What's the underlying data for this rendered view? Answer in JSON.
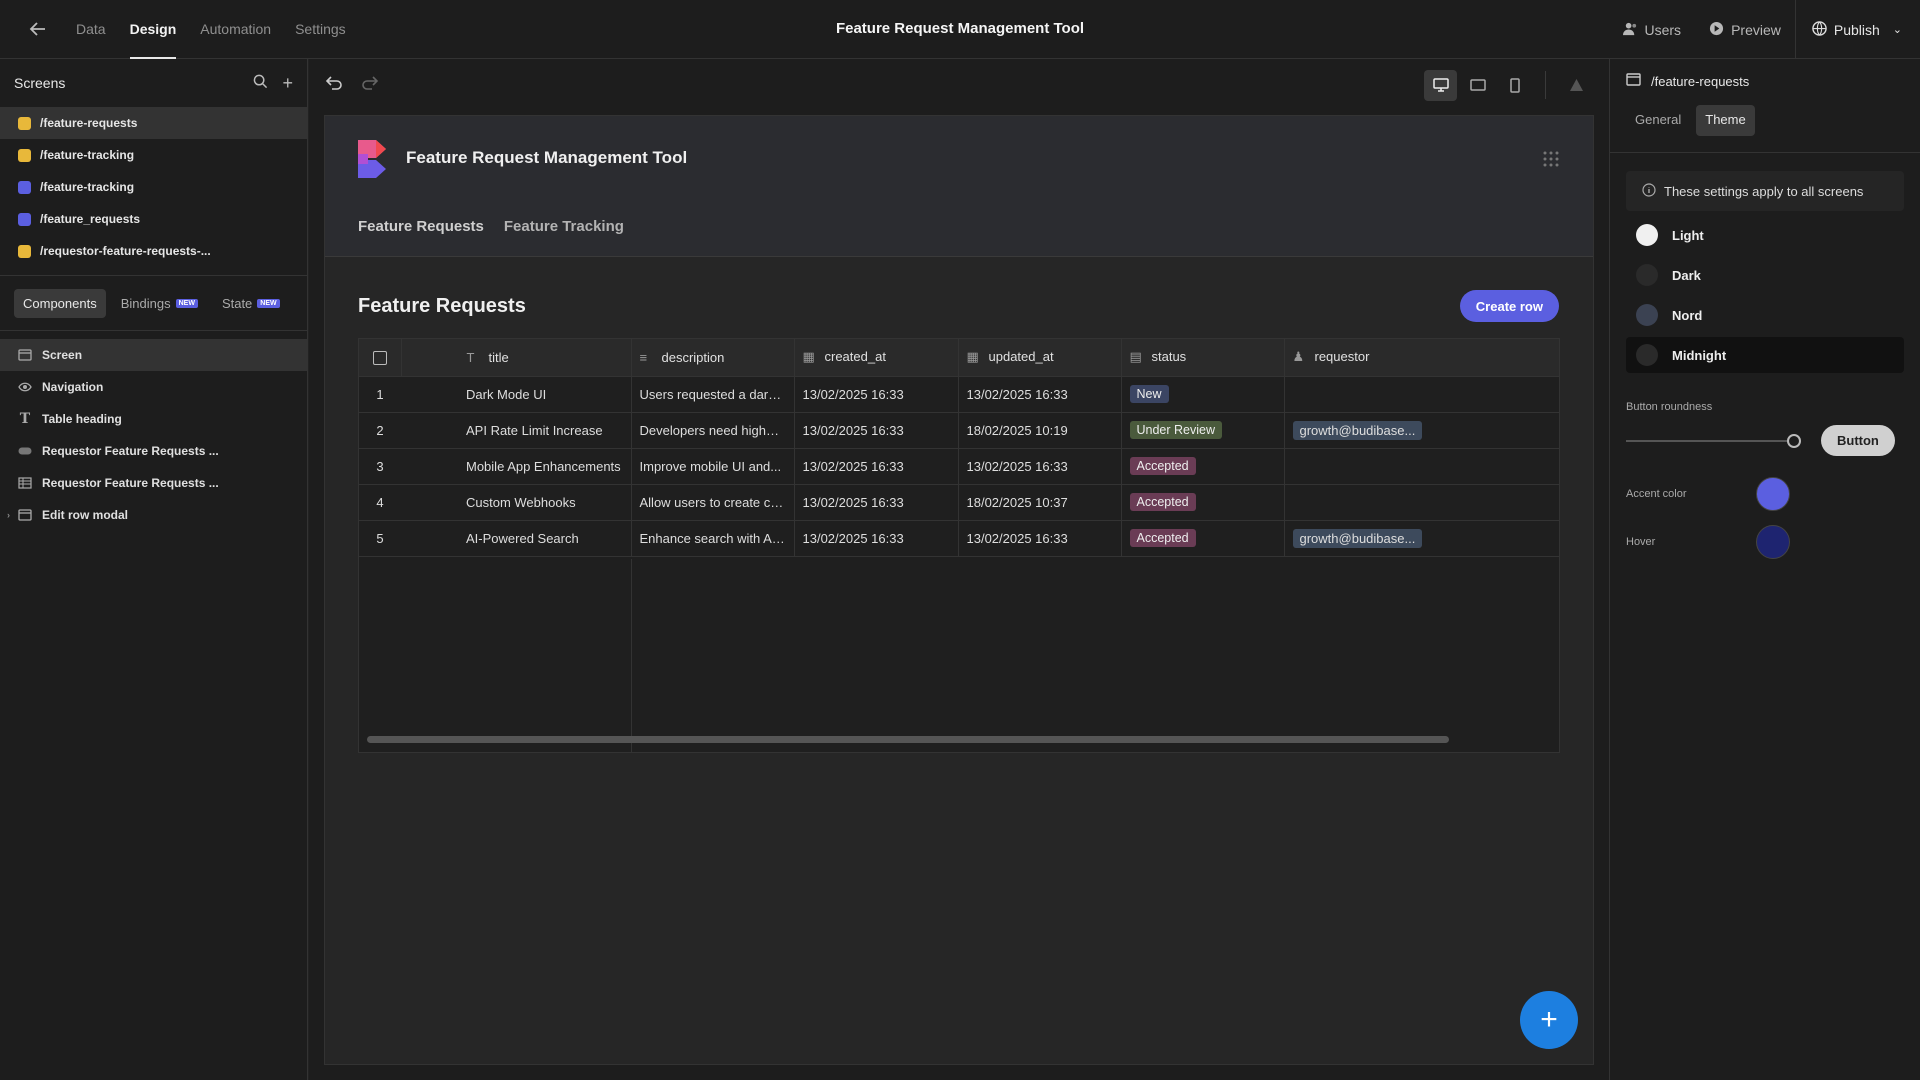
{
  "topbar": {
    "tabs": [
      "Data",
      "Design",
      "Automation",
      "Settings"
    ],
    "active_tab": "Design",
    "title": "Feature Request Management Tool",
    "users_label": "Users",
    "preview_label": "Preview",
    "publish_label": "Publish"
  },
  "left_panel": {
    "screens_title": "Screens",
    "screens": [
      {
        "route": "/feature-requests",
        "color": "#e8b83a",
        "selected": true
      },
      {
        "route": "/feature-tracking",
        "color": "#e8b83a",
        "selected": false
      },
      {
        "route": "/feature-tracking",
        "color": "#5b5fe0",
        "selected": false
      },
      {
        "route": "/feature_requests",
        "color": "#5b5fe0",
        "selected": false
      },
      {
        "route": "/requestor-feature-requests-...",
        "color": "#e8b83a",
        "selected": false
      }
    ],
    "component_tabs": {
      "components": "Components",
      "bindings": "Bindings",
      "state": "State",
      "new_badge": "NEW"
    },
    "tree": [
      {
        "label": "Screen",
        "icon": "screen-icon"
      },
      {
        "label": "Navigation",
        "icon": "eye-icon"
      },
      {
        "label": "Table heading",
        "icon": "text-icon"
      },
      {
        "label": "Requestor Feature Requests ...",
        "icon": "button-icon"
      },
      {
        "label": "Requestor Feature Requests ...",
        "icon": "table-icon"
      },
      {
        "label": "Edit row modal",
        "icon": "modal-icon"
      }
    ]
  },
  "app": {
    "title": "Feature Request Management Tool",
    "nav": [
      "Feature Requests",
      "Feature Tracking"
    ],
    "section_title": "Feature Requests",
    "create_row_label": "Create row",
    "columns": [
      {
        "label": "title",
        "icon": "text-type-icon"
      },
      {
        "label": "description",
        "icon": "paragraph-icon"
      },
      {
        "label": "created_at",
        "icon": "calendar-icon"
      },
      {
        "label": "updated_at",
        "icon": "calendar-icon"
      },
      {
        "label": "status",
        "icon": "list-icon"
      },
      {
        "label": "requestor",
        "icon": "user-icon"
      }
    ],
    "rows": [
      {
        "num": "1",
        "title": "Dark Mode UI",
        "description": "Users requested a dark them...",
        "created_at": "13/02/2025 16:33",
        "updated_at": "13/02/2025 16:33",
        "status": "New",
        "requestor": ""
      },
      {
        "num": "2",
        "title": "API Rate Limit Increase",
        "description": "Developers need higher rate...",
        "created_at": "13/02/2025 16:33",
        "updated_at": "18/02/2025 10:19",
        "status": "Under Review",
        "requestor": "growth@budibase..."
      },
      {
        "num": "3",
        "title": "Mobile App Enhancements",
        "description": "Improve mobile UI and...",
        "created_at": "13/02/2025 16:33",
        "updated_at": "13/02/2025 16:33",
        "status": "Accepted",
        "requestor": ""
      },
      {
        "num": "4",
        "title": "Custom Webhooks",
        "description": "Allow users to create custom...",
        "created_at": "13/02/2025 16:33",
        "updated_at": "18/02/2025 10:37",
        "status": "Accepted",
        "requestor": ""
      },
      {
        "num": "5",
        "title": "AI-Powered Search",
        "description": "Enhance search with AI for...",
        "created_at": "13/02/2025 16:33",
        "updated_at": "13/02/2025 16:33",
        "status": "Accepted",
        "requestor": "growth@budibase..."
      }
    ]
  },
  "right_panel": {
    "route": "/feature-requests",
    "tabs": [
      "General",
      "Theme"
    ],
    "active_tab": "Theme",
    "info_text": "These settings apply to all screens",
    "themes": [
      {
        "label": "Light",
        "color": "#f0f0f0",
        "selected": false
      },
      {
        "label": "Dark",
        "color": "#2a2a2a",
        "selected": false
      },
      {
        "label": "Nord",
        "color": "#3b4252",
        "selected": false
      },
      {
        "label": "Midnight",
        "color": "#2a2a2a",
        "selected": true
      }
    ],
    "button_roundness_label": "Button roundness",
    "button_preview_label": "Button",
    "button_roundness_value": 1.0,
    "accent_color_label": "Accent color",
    "accent_color": "#5b5fe0",
    "hover_label": "Hover",
    "hover_color": "#1e2470"
  }
}
